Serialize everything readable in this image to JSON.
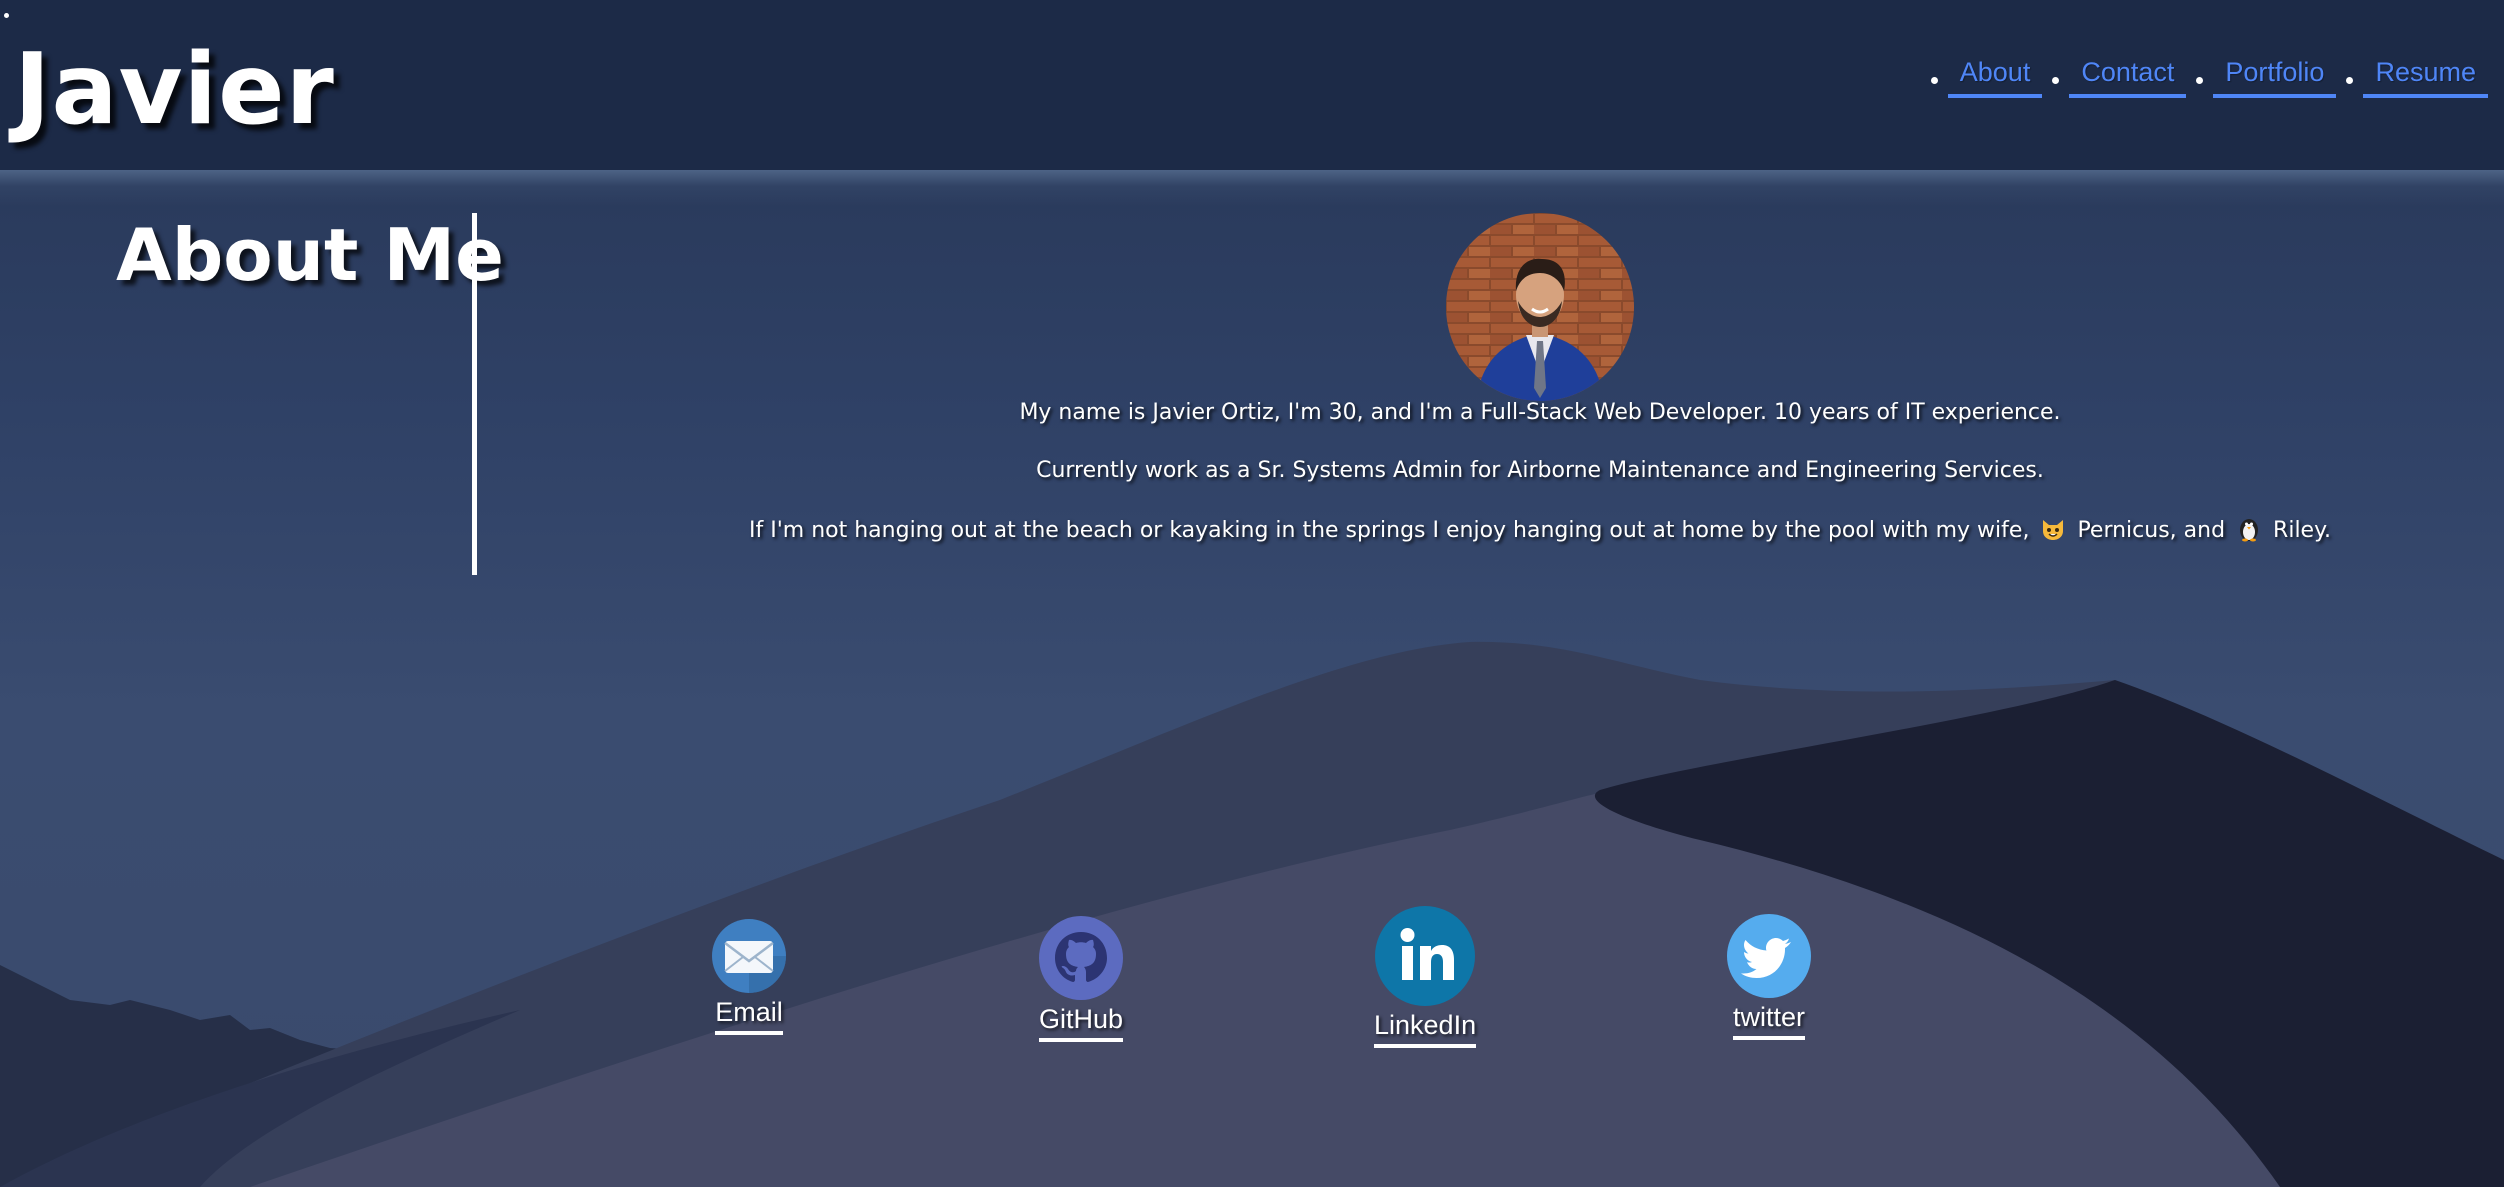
{
  "header": {
    "title": "Javier",
    "nav": [
      {
        "label": "About"
      },
      {
        "label": "Contact"
      },
      {
        "label": "Portfolio"
      },
      {
        "label": "Resume"
      }
    ]
  },
  "about": {
    "heading": "About Me",
    "paragraphs": {
      "intro": "My name is Javier Ortiz, I'm 30, and I'm a Full-Stack Web Developer. 10 years of IT experience.",
      "work": "Currently work as a Sr. Systems Admin for Airborne Maintenance and Engineering Services.",
      "hobbies_before": "If I'm not hanging out at the beach or kayaking in the springs I enjoy hanging out at home by the pool with my wife,",
      "pet1": "Pernicus, and",
      "pet2": "Riley."
    }
  },
  "social": [
    {
      "label": "Email",
      "icon": "envelope-icon"
    },
    {
      "label": "GitHub",
      "icon": "github-icon"
    },
    {
      "label": "LinkedIn",
      "icon": "linkedin-icon"
    },
    {
      "label": "twitter",
      "icon": "twitter-icon"
    }
  ],
  "colors": {
    "header_bg": "#1c2a47",
    "nav_link": "#4f86f7",
    "github": "#5c6bc0",
    "linkedin": "#0e76a8",
    "twitter": "#55acee",
    "email": "#3f7fc1"
  }
}
